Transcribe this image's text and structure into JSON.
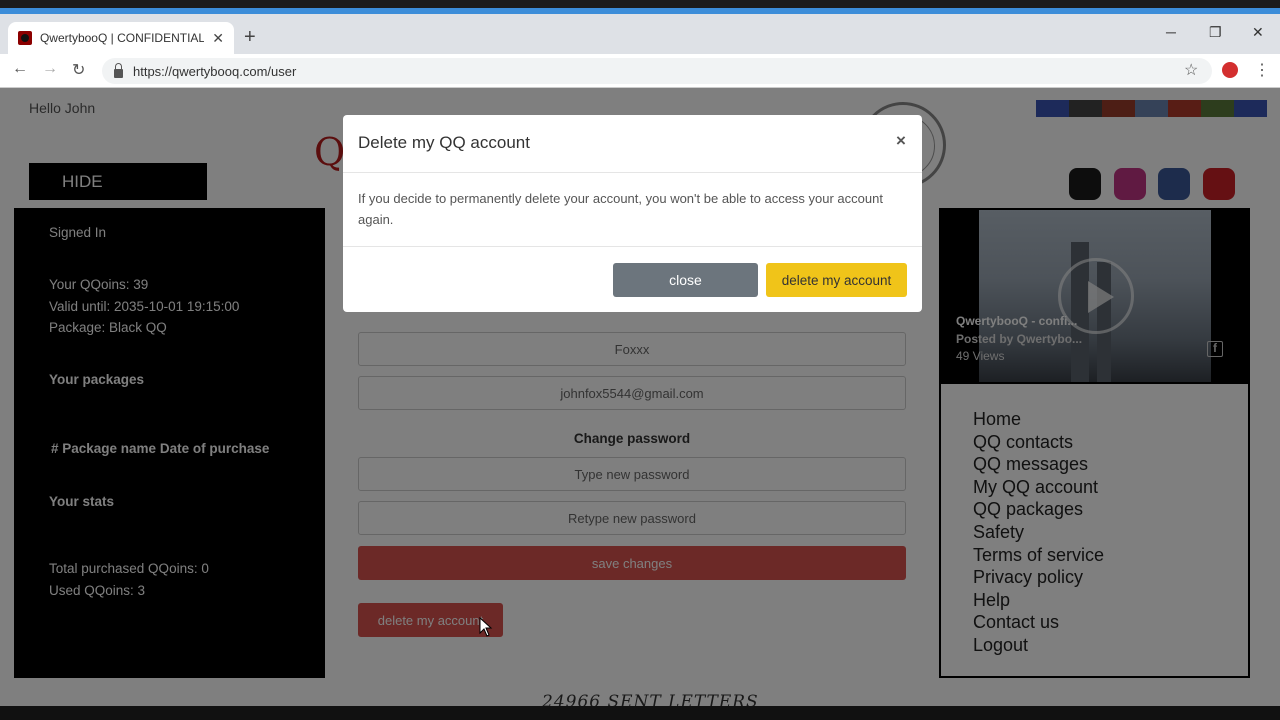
{
  "browser": {
    "tab_title": "QwertybooQ | CONFIDENTIAL W",
    "tab_close": "✕",
    "new_tab": "+",
    "url": "https://qwertybooq.com/user",
    "window_controls": {
      "minimize": "─",
      "maximize": "❐",
      "close": "✕"
    },
    "nav": {
      "back": "←",
      "forward": "→",
      "reload": "↻"
    },
    "star": "☆",
    "menu": "⋮"
  },
  "header": {
    "greeting": "Hello John",
    "brand_letter": "Q",
    "hide_button": "HIDE",
    "flags": [
      "#3a55b4",
      "#444444",
      "#9a3d2a",
      "#6a85b0",
      "#b03a2a",
      "#5a7a3a",
      "#3a55b4"
    ],
    "social": [
      {
        "name": "qq-icon",
        "color": "#1a1a1a"
      },
      {
        "name": "instagram-icon",
        "color": "#c13584"
      },
      {
        "name": "facebook-icon",
        "color": "#3b5998"
      },
      {
        "name": "pinterest-icon",
        "color": "#cb2027"
      }
    ]
  },
  "sidebar": {
    "signed_in": "Signed In",
    "qqoins": "Your QQoins: 39",
    "valid_until": "Valid until: 2035-10-01 19:15:00",
    "package": "Package: Black QQ",
    "packages_heading": "Your packages",
    "packages_columns": "# Package name Date of purchase",
    "stats_heading": "Your stats",
    "total_purchased": "Total purchased QQoins: 0",
    "used": "Used QQoins: 3"
  },
  "form": {
    "last_name": "Foxxx",
    "email": "johnfox5544@gmail.com",
    "change_password": "Change password",
    "new_password_placeholder": "Type new password",
    "retype_password_placeholder": "Retype new password",
    "save_button": "save changes",
    "delete_button": "delete my account"
  },
  "video": {
    "title": "QwertybooQ - confi...",
    "posted_by": "Posted by Qwertybo...",
    "views": "49 Views"
  },
  "menu": [
    "Home",
    "QQ contacts",
    "QQ messages",
    "My QQ account",
    "QQ packages",
    "Safety",
    "Terms of service",
    "Privacy policy",
    "Help",
    "Contact us",
    "Logout"
  ],
  "footer": {
    "sent_letters": "24966 SENT LETTERS"
  },
  "modal": {
    "title": "Delete my QQ account",
    "close_x": "×",
    "body": "If you decide to permanently delete your account, you won't be able to access your account again.",
    "close_button": "close",
    "delete_button": "delete my account",
    "colors": {
      "close": "#6c757d",
      "delete": "#f0c419"
    }
  }
}
